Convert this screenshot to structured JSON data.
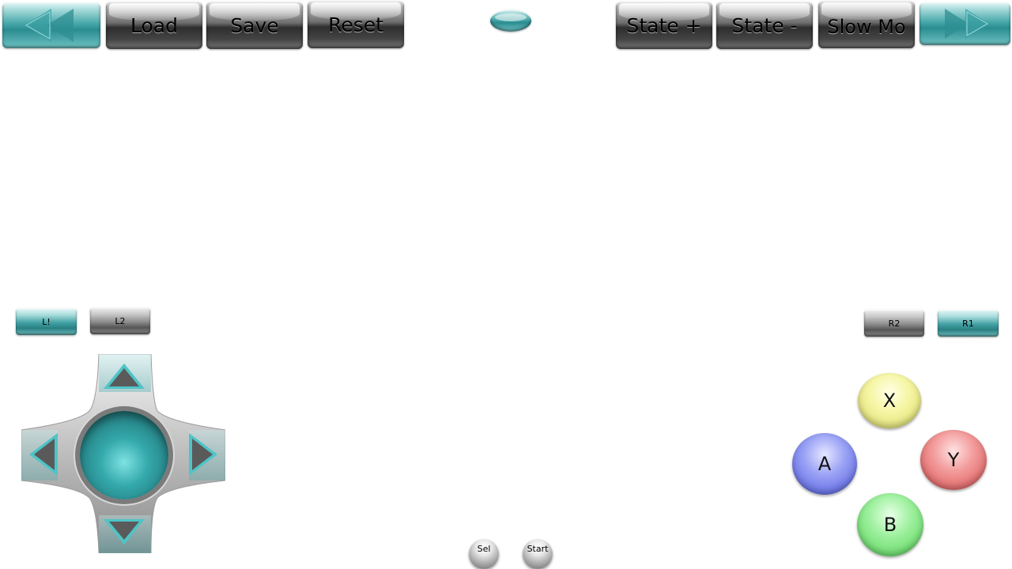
{
  "toolbar": {
    "rewind_icon": "rewind-icon",
    "load_label": "Load",
    "save_label": "Save",
    "reset_label": "Reset",
    "menu_toggle_icon": "menu-toggle-icon",
    "state_plus_label": "State +",
    "state_minus_label": "State -",
    "slow_mo_label": "Slow Mo",
    "fast_forward_icon": "fast-forward-icon"
  },
  "shoulders": {
    "l1_label": "L!",
    "l2_label": "L2",
    "r2_label": "R2",
    "r1_label": "R1"
  },
  "dpad": {
    "up_icon": "arrow-up-icon",
    "down_icon": "arrow-down-icon",
    "left_icon": "arrow-left-icon",
    "right_icon": "arrow-right-icon",
    "center_icon": "dpad-center-icon"
  },
  "face_buttons": {
    "x_label": "X",
    "y_label": "Y",
    "a_label": "A",
    "b_label": "B"
  },
  "system_buttons": {
    "select_label": "Sel",
    "start_label": "Start"
  },
  "colors": {
    "teal_accent": "#3fa5a8",
    "x_color": "#eeee88",
    "y_color": "#e86a6a",
    "a_color": "#6a74e8",
    "b_color": "#6fe26f"
  }
}
